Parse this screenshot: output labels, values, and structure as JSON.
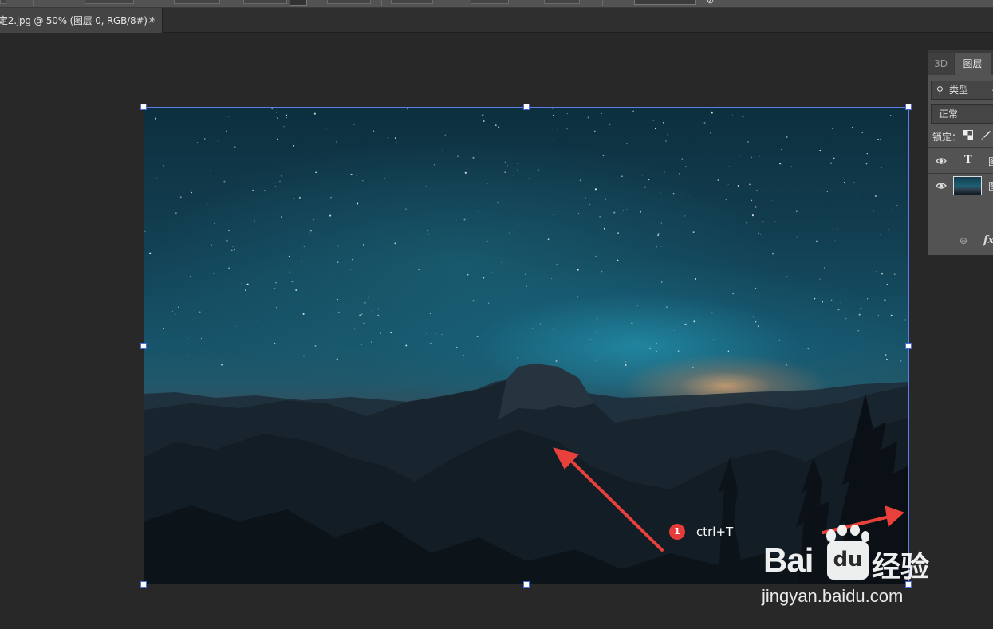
{
  "document_tab": {
    "title": "定2.jpg @ 50% (图层 0, RGB/8#) *",
    "close_glyph": "×"
  },
  "annotation": {
    "step_number": "1",
    "step_label": "ctrl+T",
    "accent_color": "#e53b3b"
  },
  "watermark": {
    "brand_bai": "Bai",
    "brand_du": "du",
    "brand_jingyan": "经验",
    "url": "jingyan.baidu.com"
  },
  "layers_panel": {
    "tabs": [
      {
        "label": "3D",
        "active": false
      },
      {
        "label": "图层",
        "active": true
      }
    ],
    "filter": {
      "label": "类型",
      "icon": "search-icon"
    },
    "blend_mode": "正常",
    "lock_label": "锁定：",
    "layers": [
      {
        "type_icon": "T",
        "name": "图",
        "kind": "text"
      },
      {
        "name": "图",
        "kind": "image"
      }
    ],
    "footer_fx": "fx"
  },
  "colors": {
    "workspace": "#282828",
    "panel": "#535353",
    "transform_border": "#5a7ce6"
  }
}
